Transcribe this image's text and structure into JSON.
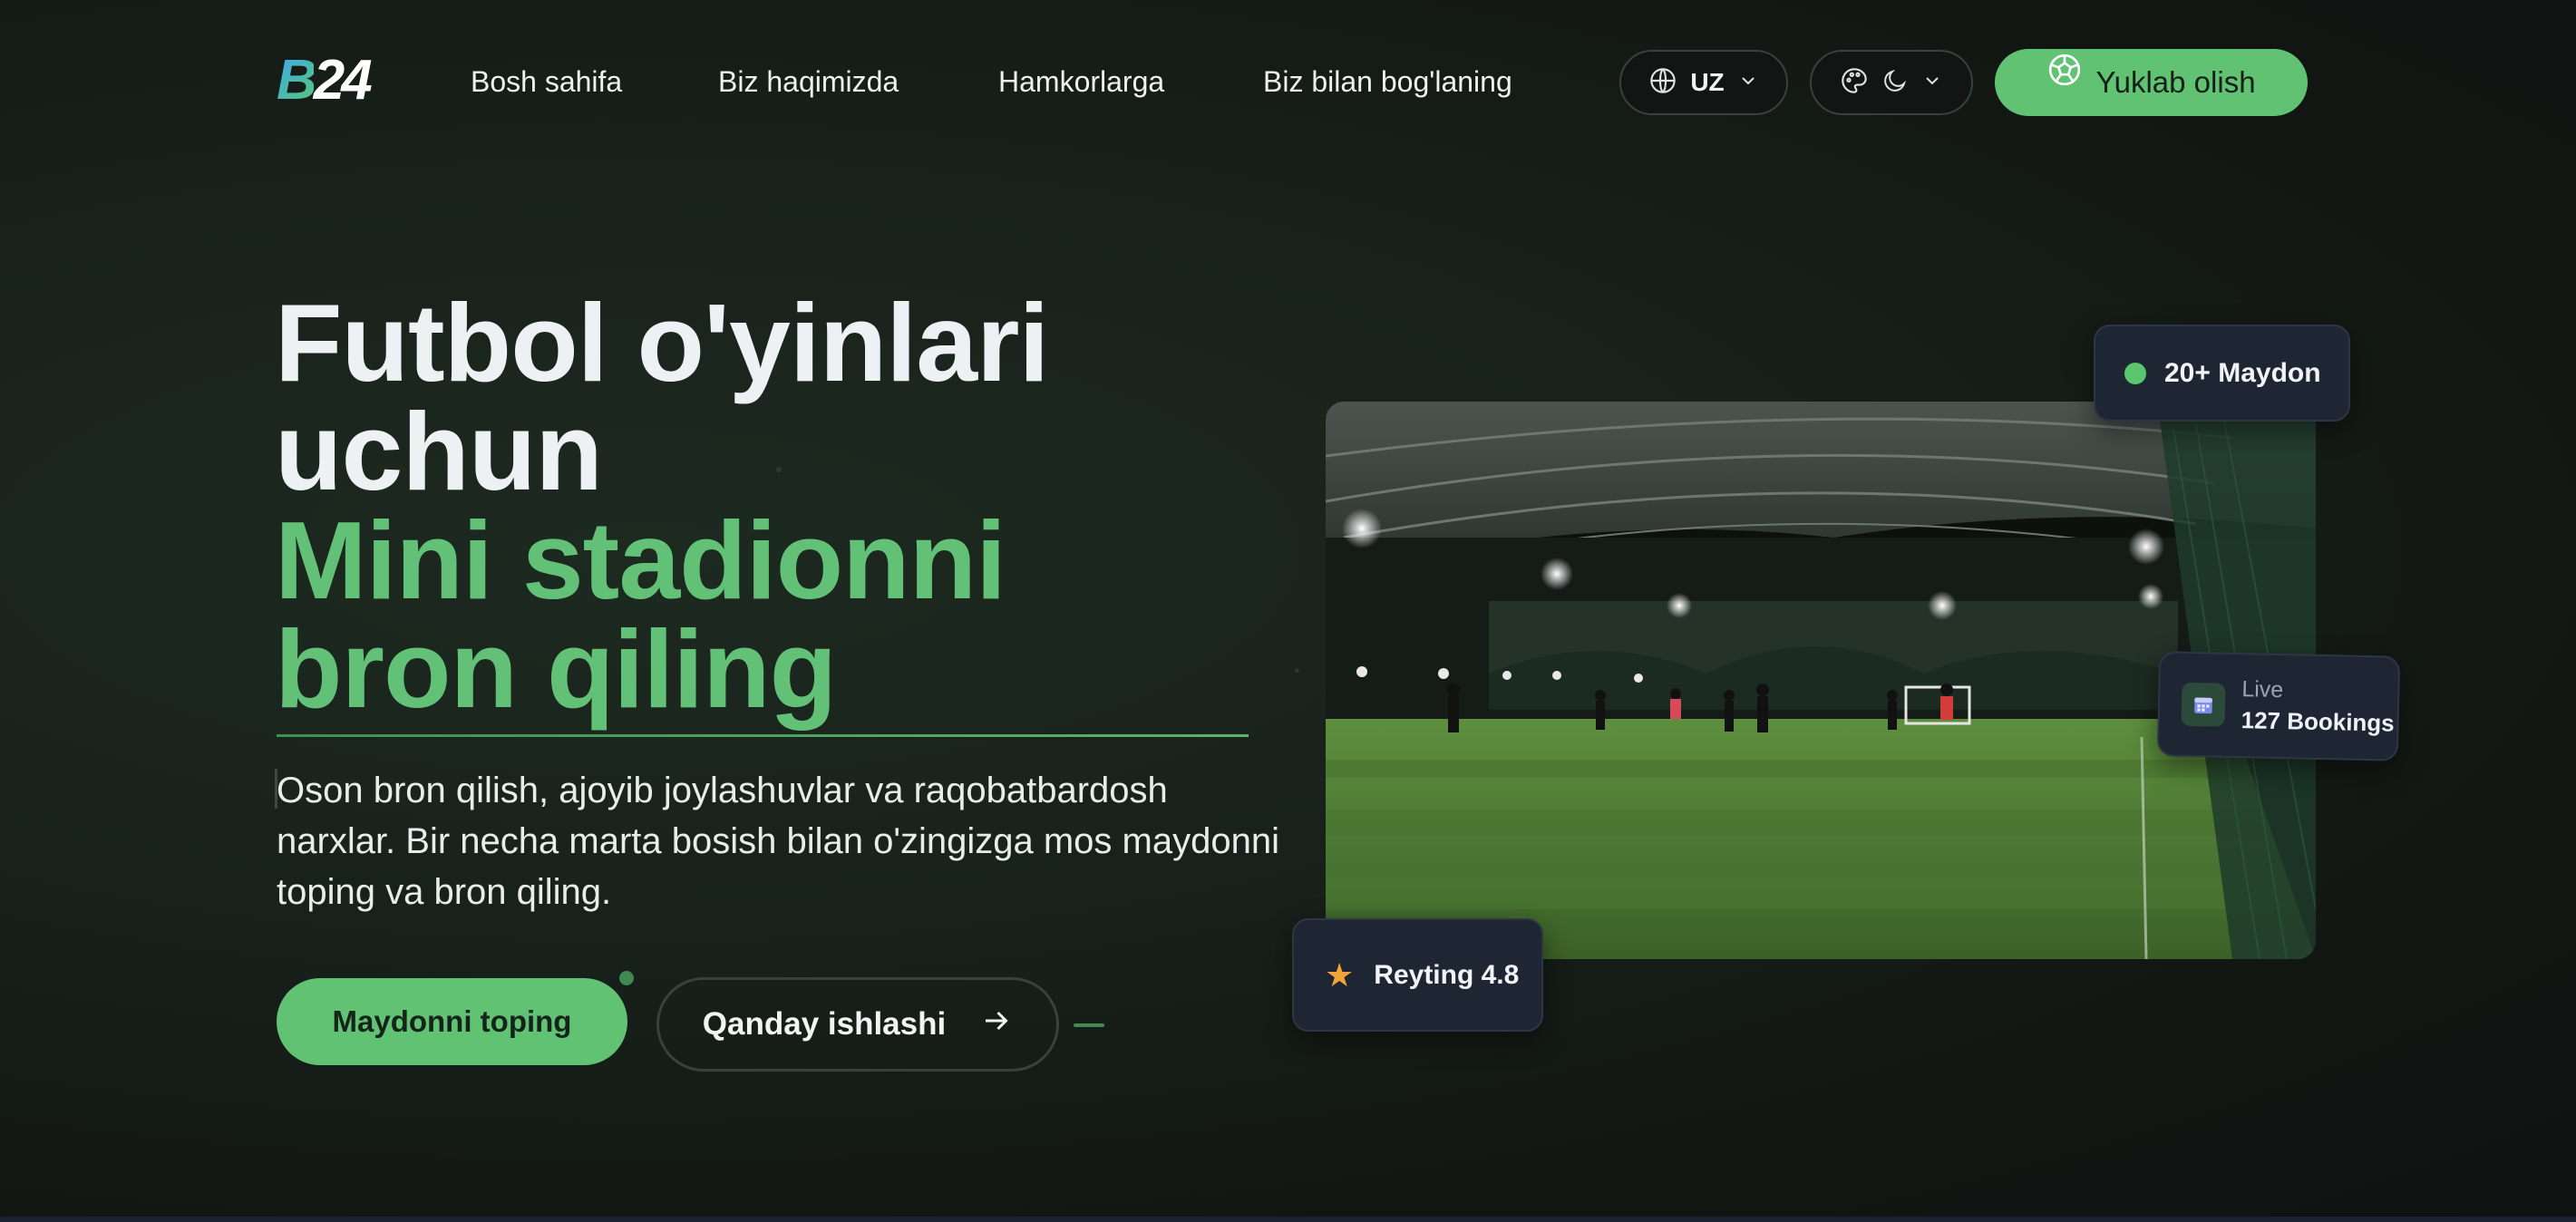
{
  "header": {
    "logo_text": "24",
    "logo_letter": "B",
    "nav": [
      {
        "label": "Bosh sahifa"
      },
      {
        "label": "Biz haqimizda"
      },
      {
        "label": "Hamkorlarga"
      },
      {
        "label": "Biz bilan bog'laning"
      }
    ],
    "language": {
      "code": "UZ",
      "icon": "globe-icon"
    },
    "theme": {
      "icons": [
        "palette-icon",
        "moon-icon"
      ]
    },
    "download_label": "Yuklab olish",
    "download_icon": "soccer-ball-icon"
  },
  "hero": {
    "title_line1": "Futbol o'yinlari",
    "title_line2": "uchun",
    "title_line3": "Mini stadionni",
    "title_line4": "bron qiling",
    "description": "Oson bron qilish, ajoyib joylashuvlar va raqobatbardosh narxlar. Bir necha marta bosish bilan o'zingizga mos maydonni toping va bron qiling.",
    "primary_button": "Maydonni toping",
    "secondary_button": "Qanday ishlashi",
    "secondary_icon": "arrow-right-icon"
  },
  "cards": {
    "fields": "20+ Maydon",
    "live_label": "Live",
    "live_count": "127 Bookings",
    "rating": "Reyting 4.8"
  },
  "colors": {
    "accent_green": "#62c274",
    "card_bg": "#1f2633",
    "background": "#18211b",
    "star": "#f0a43a"
  }
}
